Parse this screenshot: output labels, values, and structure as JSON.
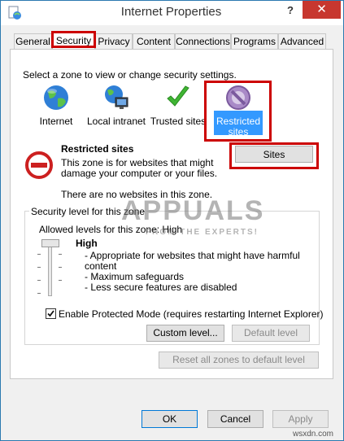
{
  "window": {
    "title": "Internet Properties",
    "help_glyph": "?",
    "close_glyph": "✕"
  },
  "tabs": [
    {
      "label": "General"
    },
    {
      "label": "Security"
    },
    {
      "label": "Privacy"
    },
    {
      "label": "Content"
    },
    {
      "label": "Connections"
    },
    {
      "label": "Programs"
    },
    {
      "label": "Advanced"
    }
  ],
  "security": {
    "zone_prompt": "Select a zone to view or change security settings.",
    "zones": [
      {
        "label": "Internet",
        "icon": "globe-icon"
      },
      {
        "label": "Local intranet",
        "icon": "intranet-icon"
      },
      {
        "label": "Trusted sites",
        "icon": "checkmark-icon"
      },
      {
        "label_line1": "Restricted",
        "label_line2": "sites",
        "icon": "restricted-icon"
      }
    ],
    "selected_zone": {
      "name": "Restricted sites",
      "desc_line1": "This zone is for websites that might",
      "desc_line2": "damage your computer or your files.",
      "status": "There are no websites in this zone.",
      "sites_button": "Sites"
    },
    "level_group": {
      "title": "Security level for this zone",
      "allowed": "Allowed levels for this zone: High",
      "level": "High",
      "bullets": [
        "- Appropriate for websites that might have harmful",
        "  content",
        "- Maximum safeguards",
        "- Less secure features are disabled"
      ],
      "slider_level": "High",
      "protected_mode": "Enable Protected Mode (requires restarting Internet Explorer)",
      "protected_mode_checked": true,
      "custom_level": "Custom level...",
      "default_level": "Default level"
    },
    "reset_all": "Reset all zones to default level"
  },
  "footer": {
    "ok": "OK",
    "cancel": "Cancel",
    "apply": "Apply"
  },
  "watermark": {
    "brand": "APPUALS",
    "tagline": "FROM THE EXPERTS!"
  },
  "source_credit": "wsxdn.com",
  "colors": {
    "highlight": "#cc0000",
    "selection": "#3399ff",
    "close": "#c7372f"
  }
}
